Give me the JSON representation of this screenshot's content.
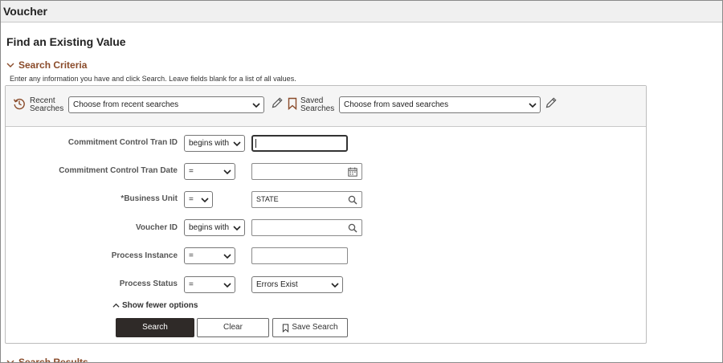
{
  "window": {
    "title": "Voucher"
  },
  "page": {
    "title": "Find an Existing Value"
  },
  "search_criteria": {
    "heading": "Search Criteria",
    "instructions": "Enter any information you have and click Search. Leave fields blank for a list of all values."
  },
  "recent": {
    "label_line1": "Recent",
    "label_line2": "Searches",
    "select_value": "Choose from recent searches"
  },
  "saved": {
    "label_line1": "Saved",
    "label_line2": "Searches",
    "select_value": "Choose from saved searches"
  },
  "fields": [
    {
      "label": "Commitment Control Tran ID",
      "operator": "begins with",
      "value": ""
    },
    {
      "label": "Commitment Control Tran Date",
      "operator": "=",
      "value": ""
    },
    {
      "label": "*Business Unit",
      "operator": "=",
      "value": "STATE"
    },
    {
      "label": "Voucher ID",
      "operator": "begins with",
      "value": ""
    },
    {
      "label": "Process Instance",
      "operator": "=",
      "value": ""
    },
    {
      "label": "Process Status",
      "operator": "=",
      "value": "Errors Exist"
    }
  ],
  "toggle_options": "Show fewer options",
  "buttons": {
    "search": "Search",
    "clear": "Clear",
    "save_search": "Save Search"
  },
  "search_results": {
    "heading": "Search Results"
  },
  "colors": {
    "accent": "#8a4b2a",
    "primary_button": "#2f2a28"
  }
}
